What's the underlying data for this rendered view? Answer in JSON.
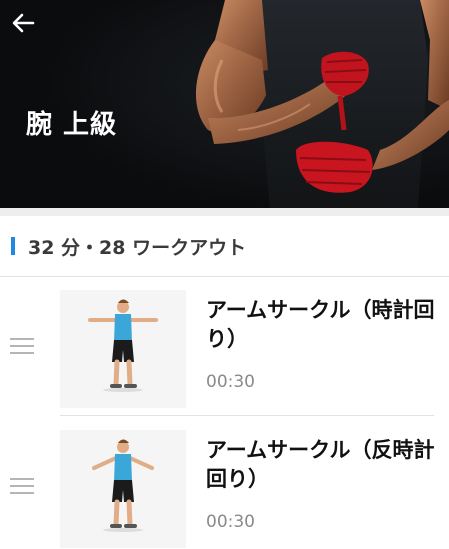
{
  "header": {
    "title": "腕 上級",
    "back_icon": "arrow-left-icon"
  },
  "summary": {
    "text": "32 分・28 ワークアウト",
    "accent_color": "#1e88e5"
  },
  "exercises": [
    {
      "name": "アームサークル（時計回り）",
      "duration": "00:30"
    },
    {
      "name": "アームサークル（反時計回り）",
      "duration": "00:30"
    }
  ]
}
